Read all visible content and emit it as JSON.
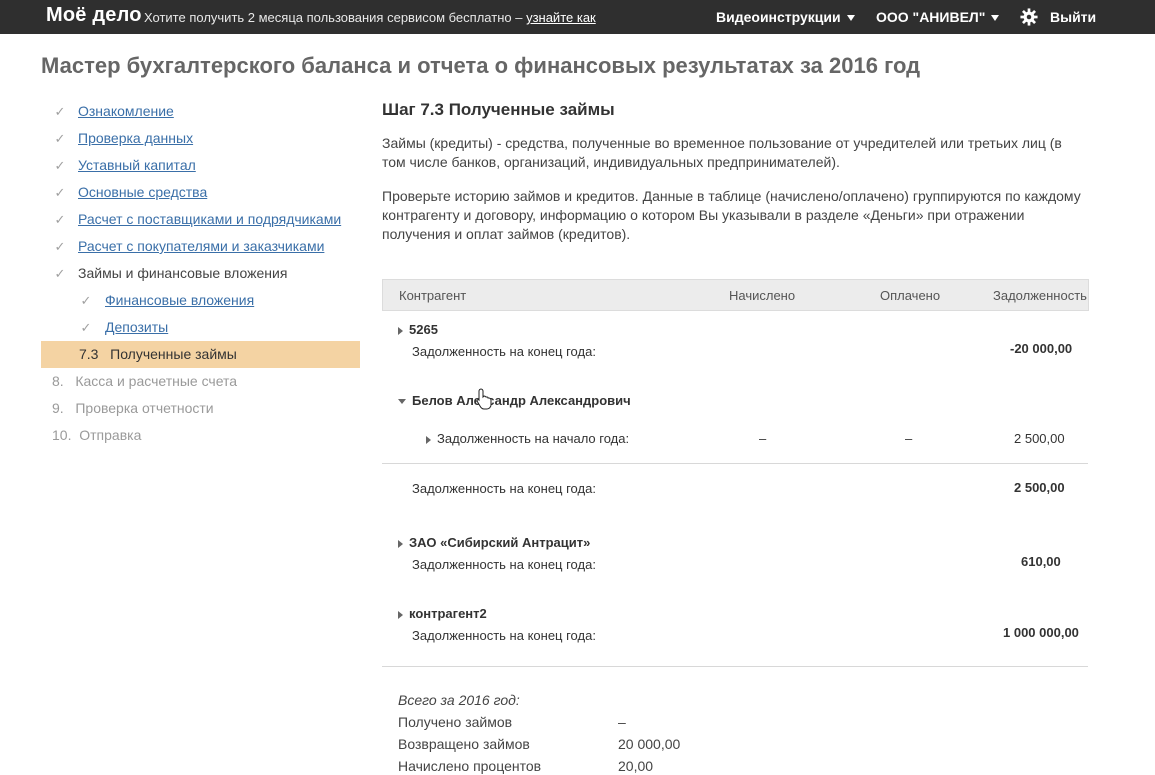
{
  "topbar": {
    "logo": "Моё дело",
    "promo_text": "Хотите получить 2 месяца пользования сервисом бесплатно – ",
    "promo_link": "узнайте как",
    "video_label": "Видеоинструкции",
    "company_label": "ООО \"АНИВЕЛ\"",
    "logout_label": "Выйти"
  },
  "page_title": "Мастер бухгалтерского баланса и отчета о финансовых результатах за 2016 год",
  "sidebar": {
    "items": [
      {
        "label": "Ознакомление"
      },
      {
        "label": "Проверка данных"
      },
      {
        "label": "Уставный капитал"
      },
      {
        "label": "Основные средства"
      },
      {
        "label": "Расчет с поставщиками и подрядчиками"
      },
      {
        "label": "Расчет с покупателями и заказчиками"
      },
      {
        "label": "Займы и финансовые вложения"
      },
      {
        "label": "Финансовые вложения"
      },
      {
        "label": "Депозиты"
      },
      {
        "label": "7.3   Полученные займы"
      },
      {
        "label": "8.   Касса и расчетные счета"
      },
      {
        "label": "9.   Проверка отчетности"
      },
      {
        "label": "10.  Отправка"
      }
    ]
  },
  "main": {
    "step_title": "Шаг 7.3 Полученные займы",
    "desc1": "Займы (кредиты) - средства, полученные во временное пользование от учредителей или третьих лиц (в том числе банков, организаций, индивидуальных предпринимателей).",
    "desc2": "Проверьте историю займов и кредитов. Данные в таблице (начислено/оплачено) группируются по каждому контрагенту и договору, информацию о котором Вы указывали в разделе «Деньги» при отражении получения и оплат займов (кредитов)."
  },
  "table": {
    "headers": {
      "counterparty": "Контрагент",
      "accrued": "Начислено",
      "paid": "Оплачено",
      "debt": "Задолженность"
    },
    "groups": [
      {
        "name": "5265",
        "end_label": "Задолженность на конец года:",
        "end_value": "-20 000,00"
      },
      {
        "name": "Белов Александр Александрович",
        "start_label": "Задолженность на начало года:",
        "start_accrued": "–",
        "start_paid": "–",
        "start_value": "2 500,00",
        "end_label": "Задолженность на конец года:",
        "end_value": "2 500,00"
      },
      {
        "name": "ЗАО «Сибирский Антрацит»",
        "end_label": "Задолженность на конец года:",
        "end_value": "610,00"
      },
      {
        "name": "контрагент2",
        "end_label": "Задолженность на конец года:",
        "end_value": "1 000 000,00"
      }
    ]
  },
  "summary": {
    "title": "Всего за 2016 год:",
    "rows": [
      {
        "label": "Получено займов",
        "value": "–"
      },
      {
        "label": "Возвращено займов",
        "value": "20 000,00"
      },
      {
        "label": "Начислено процентов",
        "value": "20,00"
      }
    ]
  },
  "colors": {
    "topbar": "#2f2f2f",
    "active_step": "#f4d3a3",
    "link": "#3a6fa8"
  }
}
